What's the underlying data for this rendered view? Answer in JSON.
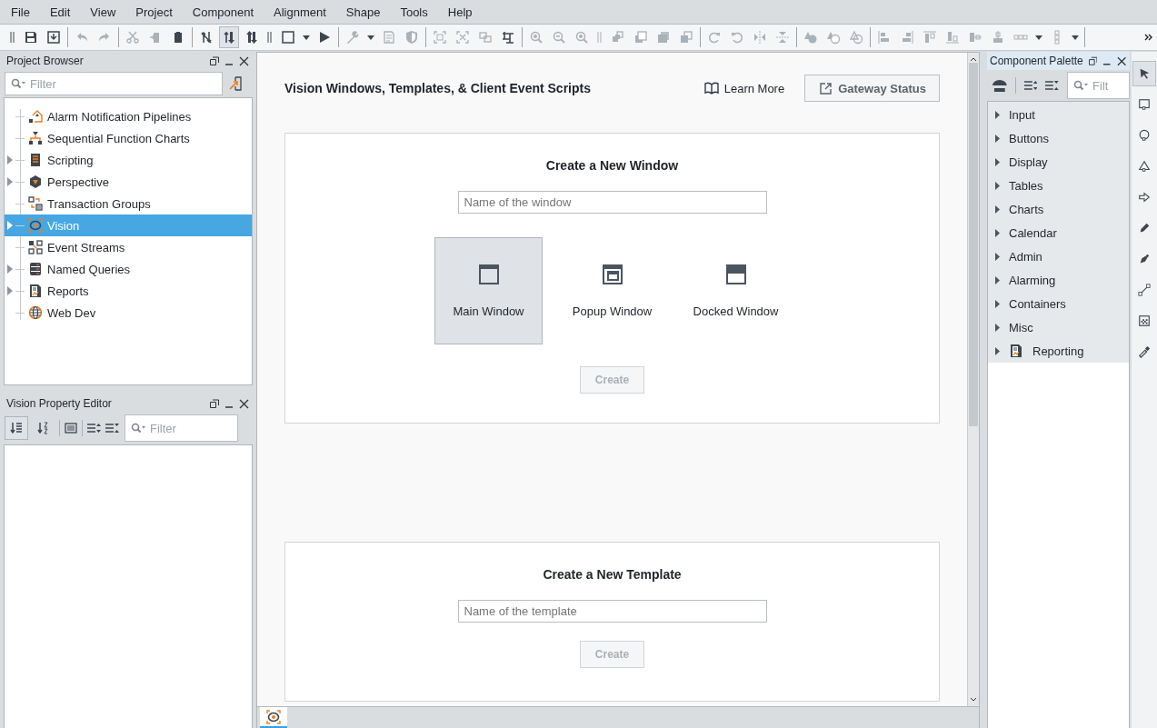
{
  "menu": [
    "File",
    "Edit",
    "View",
    "Project",
    "Component",
    "Alignment",
    "Shape",
    "Tools",
    "Help"
  ],
  "toolbar": [
    {
      "items": [
        {
          "kind": "grip",
          "disabled": false,
          "pressed": false
        },
        {
          "kind": "floppy-disk",
          "disabled": false,
          "pressed": false
        },
        {
          "kind": "tray-download",
          "disabled": false,
          "pressed": false
        }
      ]
    },
    {
      "items": [
        {
          "kind": "undo",
          "disabled": true,
          "pressed": false
        },
        {
          "kind": "redo",
          "disabled": true,
          "pressed": false
        }
      ]
    },
    {
      "items": [
        {
          "kind": "scissors",
          "disabled": true,
          "pressed": false
        },
        {
          "kind": "document-arrow",
          "disabled": true,
          "pressed": false
        },
        {
          "kind": "clipboard",
          "disabled": false,
          "pressed": false
        }
      ]
    },
    {
      "items": [
        {
          "kind": "arrows-crossed",
          "disabled": false,
          "pressed": false
        },
        {
          "kind": "arrows-updown",
          "disabled": false,
          "pressed": true
        },
        {
          "kind": "arrows-bold",
          "disabled": false,
          "pressed": false
        },
        {
          "kind": "grip",
          "disabled": false,
          "pressed": false
        },
        {
          "kind": "square",
          "disabled": false,
          "pressed": false
        },
        {
          "kind": "caret",
          "disabled": false,
          "pressed": false
        },
        {
          "kind": "play",
          "disabled": false,
          "pressed": false
        }
      ]
    },
    {
      "items": [
        {
          "kind": "wrench",
          "disabled": true,
          "pressed": false
        },
        {
          "kind": "caret",
          "disabled": false,
          "pressed": false
        },
        {
          "kind": "document",
          "disabled": true,
          "pressed": false
        },
        {
          "kind": "shield",
          "disabled": true,
          "pressed": false
        }
      ]
    },
    {
      "items": [
        {
          "kind": "corners",
          "disabled": true,
          "pressed": false
        },
        {
          "kind": "corners-x",
          "disabled": true,
          "pressed": false
        },
        {
          "kind": "squares-pair",
          "disabled": true,
          "pressed": false
        },
        {
          "kind": "squares-grid",
          "disabled": false,
          "pressed": false
        }
      ]
    },
    {
      "items": [
        {
          "kind": "zoom-in",
          "disabled": true,
          "pressed": false
        },
        {
          "kind": "zoom-out",
          "disabled": true,
          "pressed": false
        },
        {
          "kind": "zoom-in",
          "disabled": true,
          "pressed": false
        },
        {
          "kind": "grip",
          "disabled": true,
          "pressed": false
        },
        {
          "kind": "layers-front",
          "disabled": true,
          "pressed": false
        },
        {
          "kind": "layer-outline",
          "disabled": true,
          "pressed": false
        },
        {
          "kind": "layer-solid",
          "disabled": true,
          "pressed": false
        },
        {
          "kind": "layers-back",
          "disabled": true,
          "pressed": false
        }
      ]
    },
    {
      "items": [
        {
          "kind": "rotate-cw",
          "disabled": true,
          "pressed": false
        },
        {
          "kind": "rotate-ccw",
          "disabled": true,
          "pressed": false
        },
        {
          "kind": "mirror-h",
          "disabled": true,
          "pressed": false
        },
        {
          "kind": "mirror-v",
          "disabled": true,
          "pressed": false
        }
      ]
    },
    {
      "items": [
        {
          "kind": "shapes-solid",
          "disabled": true,
          "pressed": false
        },
        {
          "kind": "shapes-outline",
          "disabled": true,
          "pressed": false
        },
        {
          "kind": "shapes-overlap",
          "disabled": true,
          "pressed": false
        }
      ]
    },
    {
      "items": [
        {
          "kind": "align-left",
          "disabled": true,
          "pressed": false
        },
        {
          "kind": "align-right",
          "disabled": true,
          "pressed": false
        },
        {
          "kind": "align-top",
          "disabled": true,
          "pressed": false
        },
        {
          "kind": "align-bottom",
          "disabled": true,
          "pressed": false
        },
        {
          "kind": "align-center",
          "disabled": true,
          "pressed": false
        },
        {
          "kind": "align-middle",
          "disabled": true,
          "pressed": false
        },
        {
          "kind": "dots-row",
          "disabled": true,
          "pressed": false
        },
        {
          "kind": "caret",
          "disabled": false,
          "pressed": false
        },
        {
          "kind": "dots-column",
          "disabled": true,
          "pressed": false
        },
        {
          "kind": "caret",
          "disabled": false,
          "pressed": false
        }
      ]
    }
  ],
  "project_browser": {
    "title": "Project Browser",
    "filter_placeholder": "Filter",
    "items": [
      {
        "label": "Alarm Notification Pipelines",
        "kind": "alarm",
        "expandable": false,
        "selected": false
      },
      {
        "label": "Sequential Function Charts",
        "kind": "flowchart",
        "expandable": false,
        "selected": false
      },
      {
        "label": "Scripting",
        "kind": "script",
        "expandable": true,
        "selected": false
      },
      {
        "label": "Perspective",
        "kind": "hexagon",
        "expandable": true,
        "selected": false
      },
      {
        "label": "Transaction Groups",
        "kind": "transaction",
        "expandable": false,
        "selected": false
      },
      {
        "label": "Vision",
        "kind": "eye",
        "expandable": true,
        "selected": true
      },
      {
        "label": "Event Streams",
        "kind": "nodes",
        "expandable": false,
        "selected": false
      },
      {
        "label": "Named Queries",
        "kind": "database",
        "expandable": true,
        "selected": false
      },
      {
        "label": "Reports",
        "kind": "report",
        "expandable": true,
        "selected": false
      },
      {
        "label": "Web Dev",
        "kind": "globe",
        "expandable": false,
        "selected": false
      }
    ]
  },
  "property_editor": {
    "title": "Vision Property Editor",
    "filter_placeholder": "Filter",
    "sort_modes": [
      {
        "kind": "sort-category",
        "selected": true
      },
      {
        "kind": "sort-alpha",
        "selected": false
      }
    ]
  },
  "workspace": {
    "title": "Vision Windows, Templates, & Client Event Scripts",
    "learn_more": "Learn More",
    "gateway_status": "Gateway Status",
    "new_window": {
      "title": "Create a New Window",
      "placeholder": "Name of the window",
      "types": [
        {
          "label": "Main Window",
          "kind": "main",
          "selected": true
        },
        {
          "label": "Popup Window",
          "kind": "popup",
          "selected": false
        },
        {
          "label": "Docked Window",
          "kind": "docked",
          "selected": false
        }
      ],
      "create": "Create",
      "create_disabled": true
    },
    "new_template": {
      "title": "Create a New Template",
      "placeholder": "Name of the template",
      "create": "Create",
      "create_disabled": true
    },
    "tabs": [
      {
        "kind": "eye",
        "selected": true
      }
    ]
  },
  "component_palette": {
    "title": "Component Palette",
    "filter_placeholder": "Filt",
    "items": [
      {
        "label": "Input",
        "kind": "category"
      },
      {
        "label": "Buttons",
        "kind": "category"
      },
      {
        "label": "Display",
        "kind": "category"
      },
      {
        "label": "Tables",
        "kind": "category"
      },
      {
        "label": "Charts",
        "kind": "category"
      },
      {
        "label": "Calendar",
        "kind": "category"
      },
      {
        "label": "Admin",
        "kind": "category"
      },
      {
        "label": "Alarming",
        "kind": "category"
      },
      {
        "label": "Containers",
        "kind": "category"
      },
      {
        "label": "Misc",
        "kind": "category"
      },
      {
        "label": "Reporting",
        "kind": "report"
      }
    ]
  },
  "tools": [
    {
      "kind": "pointer",
      "selected": true
    },
    {
      "kind": "rectangle",
      "selected": false
    },
    {
      "kind": "ellipse",
      "selected": false
    },
    {
      "kind": "polygon",
      "selected": false
    },
    {
      "kind": "arrow",
      "selected": false
    },
    {
      "kind": "pencil",
      "selected": false
    },
    {
      "kind": "pen",
      "selected": false
    },
    {
      "kind": "line",
      "selected": false
    },
    {
      "kind": "gradient",
      "selected": false
    },
    {
      "kind": "eyedropper",
      "selected": false
    }
  ]
}
